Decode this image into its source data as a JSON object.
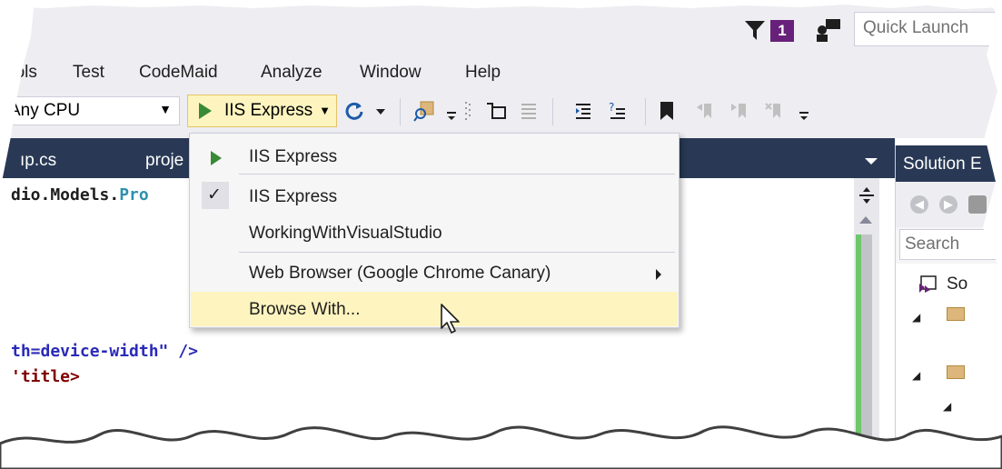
{
  "titlebar": {
    "notification_count": "1",
    "quick_launch_placeholder": "Quick Launch"
  },
  "menubar": {
    "items": [
      "ools",
      "Test",
      "CodeMaid",
      "Analyze",
      "Window",
      "Help"
    ]
  },
  "toolbar": {
    "platform": "Any CPU",
    "run_target": "IIS Express"
  },
  "tabs": [
    "ıp.cs",
    "proje"
  ],
  "editor": {
    "line1": {
      "ns": "dio.Models.",
      "type": "Pro"
    },
    "line2": {
      "attr": "th=device-width\"",
      "rest": " />"
    },
    "line3": {
      "tag": "'title>"
    }
  },
  "dropdown": {
    "items": [
      {
        "label": "IIS Express",
        "marker": "play"
      },
      {
        "label": "IIS Express",
        "marker": "check",
        "check_glyph": "✓"
      },
      {
        "label": "WorkingWithVisualStudio",
        "marker": "none"
      },
      {
        "label": "Web Browser (Google Chrome Canary)",
        "marker": "submenu"
      },
      {
        "label": "Browse With...",
        "marker": "none",
        "highlighted": true
      }
    ]
  },
  "solution_explorer": {
    "title": "Solution E",
    "search_placeholder": "Search",
    "tree": [
      "So"
    ]
  },
  "colors": {
    "accent": "#68217a",
    "tab_well": "#293955",
    "run_highlight": "#fdf4bf",
    "play_green": "#388a34",
    "change_bar": "#6ec76a"
  },
  "icons": [
    "filter-icon",
    "feedback-icon",
    "play-icon",
    "refresh-icon",
    "find-icon",
    "bookmark-icon",
    "cursor-icon"
  ]
}
